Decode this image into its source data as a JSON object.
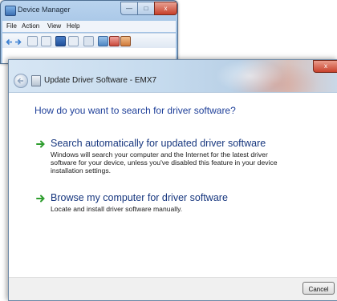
{
  "device_manager": {
    "title": "Device Manager",
    "menu": [
      "File",
      "Action",
      "View",
      "Help"
    ],
    "toolbar_icons": [
      "back-icon",
      "forward-icon",
      "properties-icon",
      "list-icon",
      "help-icon",
      "grid-icon",
      "scan-icon",
      "update-driver-icon",
      "disable-icon",
      "uninstall-icon"
    ],
    "caption_buttons": {
      "minimize": "—",
      "maximize": "□",
      "close": "x"
    }
  },
  "wizard": {
    "title": "Update Driver Software - EMX7",
    "close_label": "x",
    "back_icon": "back-arrow-icon",
    "question": "How do you want to search for driver software?",
    "options": [
      {
        "icon": "green-arrow-icon",
        "title": "Search automatically for updated driver software",
        "description": "Windows will search your computer and the Internet for the latest driver software for your device, unless you've disabled this feature in your device installation settings."
      },
      {
        "icon": "green-arrow-icon",
        "title": "Browse my computer for driver software",
        "description": "Locate and install driver software manually."
      }
    ],
    "cancel_label": "Cancel"
  },
  "colors": {
    "link_blue": "#16367e",
    "heading_blue": "#1e3f99",
    "arrow_green": "#2f9e2f"
  }
}
